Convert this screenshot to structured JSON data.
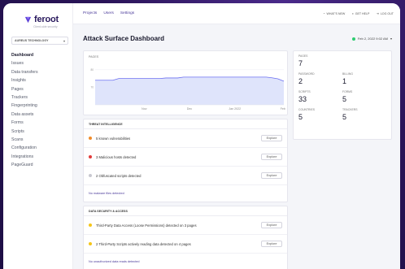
{
  "brand": {
    "name": "feroot",
    "tagline": "Client-side security"
  },
  "org": {
    "selected": "AUREUS TECHNOLOGY"
  },
  "sidebar": {
    "items": [
      {
        "label": "Dashboard",
        "active": true
      },
      {
        "label": "Issues"
      },
      {
        "label": "Data transfers"
      },
      {
        "label": "Insights"
      },
      {
        "label": "Pages"
      },
      {
        "label": "Trackers"
      },
      {
        "label": "Fingerprinting"
      },
      {
        "label": "Data assets"
      },
      {
        "label": "Forms"
      },
      {
        "label": "Scripts"
      },
      {
        "label": "Scans"
      },
      {
        "label": "Configuration"
      },
      {
        "label": "Integrations"
      },
      {
        "label": "PageGuard"
      }
    ]
  },
  "topbar": {
    "tabs": [
      "Projects",
      "Users",
      "Settings"
    ],
    "links": [
      "WHAT'S NEW",
      "GET HELP",
      "LOG OUT"
    ]
  },
  "page": {
    "title": "Attack Surface Dashboard",
    "date": "Feb 2, 2022 9:02 AM"
  },
  "chart_data": {
    "type": "area",
    "title": "PAGES",
    "x_ticks": [
      "Nov",
      "Dec",
      "Jan 2022",
      "Feb"
    ],
    "y_ticks": [
      80,
      70
    ],
    "ylim": [
      60,
      85
    ],
    "x": [
      0,
      0.5,
      1,
      1.5,
      2,
      2.5,
      3,
      3.5,
      4,
      4.5,
      5,
      5.5,
      6,
      6.5,
      7,
      7.5,
      8,
      8.5,
      9,
      9.5,
      10,
      10.5,
      11,
      11.5,
      12,
      12.5,
      13,
      13.5,
      14,
      14.5,
      15,
      15.5,
      16
    ],
    "values": [
      74,
      74,
      74,
      74,
      75,
      75,
      75,
      75,
      75,
      75,
      75,
      75,
      75.3,
      75.3,
      75.3,
      75.8,
      75.8,
      75.8,
      75.8,
      75.8,
      75.8,
      75.8,
      75.8,
      75.8,
      75.8,
      75.8,
      75.8,
      75.8,
      75.8,
      75.8,
      75.4,
      74.8,
      73.5
    ],
    "colors": {
      "line": "#6b6ff0",
      "fill": "#dfe4fb"
    }
  },
  "threat": {
    "title": "THREAT INTELLIGENCE",
    "rows": [
      {
        "text": "5 known vulnerabilities",
        "color": "#f08c2a",
        "button": "Explore"
      },
      {
        "text": "3 Malicious hosts detected",
        "color": "#e23b3b",
        "button": "Explore"
      },
      {
        "text": "2 Obfuscated scripts detected",
        "color": "#c8c8d0",
        "button": "Explore"
      }
    ],
    "note": "No malware files detected"
  },
  "datasec": {
    "title": "DATA SECURITY & ACCESS",
    "rows": [
      {
        "text": "Third-Party Data Access (Loose Permissions) detected on 3 pages",
        "color": "#f5c518",
        "button": "Explore"
      },
      {
        "text": "2 Third-Party Scripts actively reading data detected on 4 pages",
        "color": "#f5c518",
        "button": "Explore"
      }
    ],
    "note": "No unauthorized data reads detected"
  },
  "stats": {
    "pages": {
      "label": "PAGES",
      "value": "7"
    },
    "passwords": {
      "label": "PASSWORD",
      "value": "2"
    },
    "billing": {
      "label": "BILLING",
      "value": "1"
    },
    "scripts": {
      "label": "SCRIPTS",
      "value": "33"
    },
    "forms": {
      "label": "FORMS",
      "value": "5"
    },
    "countries": {
      "label": "COUNTRIES",
      "value": "5"
    },
    "trackers": {
      "label": "TRACKERS",
      "value": "5"
    }
  }
}
